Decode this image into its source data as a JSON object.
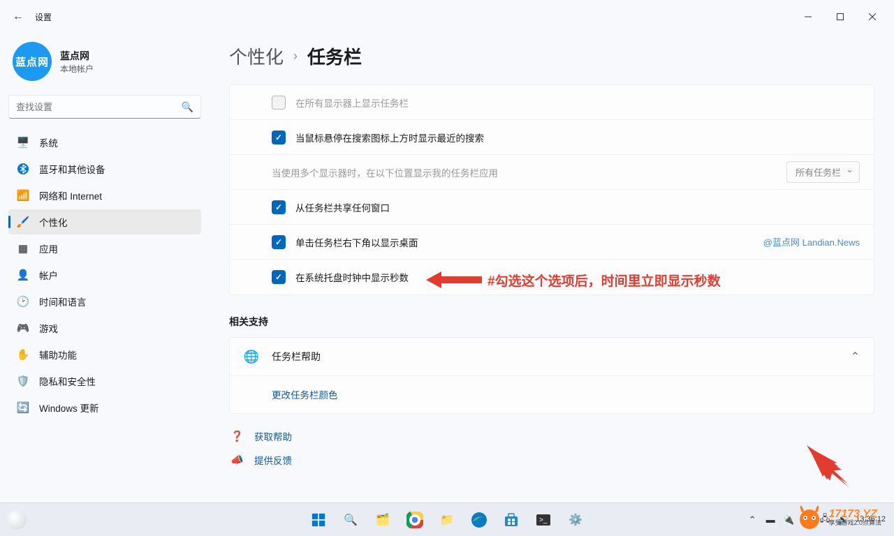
{
  "window": {
    "title": "设置"
  },
  "profile": {
    "avatar_text": "蓝点网",
    "name": "蓝点网",
    "subtitle": "本地帐户"
  },
  "search": {
    "placeholder": "查找设置"
  },
  "nav": {
    "items": [
      {
        "label": "系统",
        "icon": "🖥️"
      },
      {
        "label": "蓝牙和其他设备",
        "icon": "bt"
      },
      {
        "label": "网络和 Internet",
        "icon": "📶"
      },
      {
        "label": "个性化",
        "icon": "🖌️"
      },
      {
        "label": "应用",
        "icon": "▦"
      },
      {
        "label": "帐户",
        "icon": "👤"
      },
      {
        "label": "时间和语言",
        "icon": "🕑"
      },
      {
        "label": "游戏",
        "icon": "🎮"
      },
      {
        "label": "辅助功能",
        "icon": "✋"
      },
      {
        "label": "隐私和安全性",
        "icon": "🛡️"
      },
      {
        "label": "Windows 更新",
        "icon": "🔄"
      }
    ],
    "selected_index": 3
  },
  "breadcrumb": {
    "parent": "个性化",
    "current": "任务栏"
  },
  "settings": [
    {
      "label": "在所有显示器上显示任务栏",
      "checked": false,
      "disabled": true
    },
    {
      "label": "当鼠标悬停在搜索图标上方时显示最近的搜索",
      "checked": true
    },
    {
      "label": "当使用多个显示器时，在以下位置显示我的任务栏应用",
      "plain": true,
      "disabled": true,
      "dropdown": "所有任务栏"
    },
    {
      "label": "从任务栏共享任何窗口",
      "checked": true
    },
    {
      "label": "单击任务栏右下角以显示桌面",
      "checked": true,
      "watermark": "@蓝点网 Landian.News"
    },
    {
      "label": "在系统托盘时钟中显示秒数",
      "checked": true
    }
  ],
  "annotation": {
    "text": "#勾选这个选项后，时间里立即显示秒数"
  },
  "related": {
    "title": "相关支持",
    "expander": "任务栏帮助",
    "link": "更改任务栏颜色"
  },
  "help": {
    "get_help": "获取帮助",
    "feedback": "提供反馈"
  },
  "tray": {
    "time": "13:36:12",
    "line2": "享受游戏2.0点算法"
  },
  "brand": {
    "name": "17173.YZ",
    "sub": "享受游戏2.0点算法"
  }
}
